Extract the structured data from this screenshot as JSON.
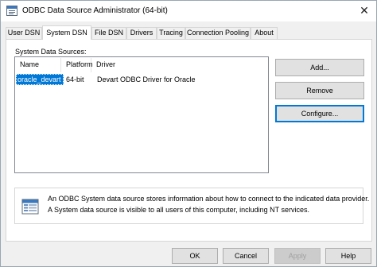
{
  "window": {
    "title": "ODBC Data Source Administrator (64-bit)",
    "close_glyph": "✕"
  },
  "tabs": [
    {
      "label": "User DSN",
      "active": false
    },
    {
      "label": "System DSN",
      "active": true
    },
    {
      "label": "File DSN",
      "active": false
    },
    {
      "label": "Drivers",
      "active": false
    },
    {
      "label": "Tracing",
      "active": false
    },
    {
      "label": "Connection Pooling",
      "active": false
    },
    {
      "label": "About",
      "active": false
    }
  ],
  "panel": {
    "section_label": "System Data Sources:",
    "columns": [
      "Name",
      "Platform",
      "Driver"
    ],
    "rows": [
      {
        "name": "oracle_devart",
        "platform": "64-bit",
        "driver": "Devart ODBC Driver for Oracle",
        "selected": true
      }
    ],
    "buttons": {
      "add": "Add...",
      "remove": "Remove",
      "configure": "Configure..."
    },
    "info": {
      "line1": "An ODBC System data source stores information about how to connect to the indicated data provider.",
      "line2": "A System data source is visible to all users of this computer, including NT services."
    }
  },
  "footer": {
    "ok": "OK",
    "cancel": "Cancel",
    "apply": "Apply",
    "help": "Help"
  },
  "colors": {
    "selection": "#0078d7",
    "window_bg": "#f0f0f0",
    "panel_bg": "#ffffff"
  }
}
